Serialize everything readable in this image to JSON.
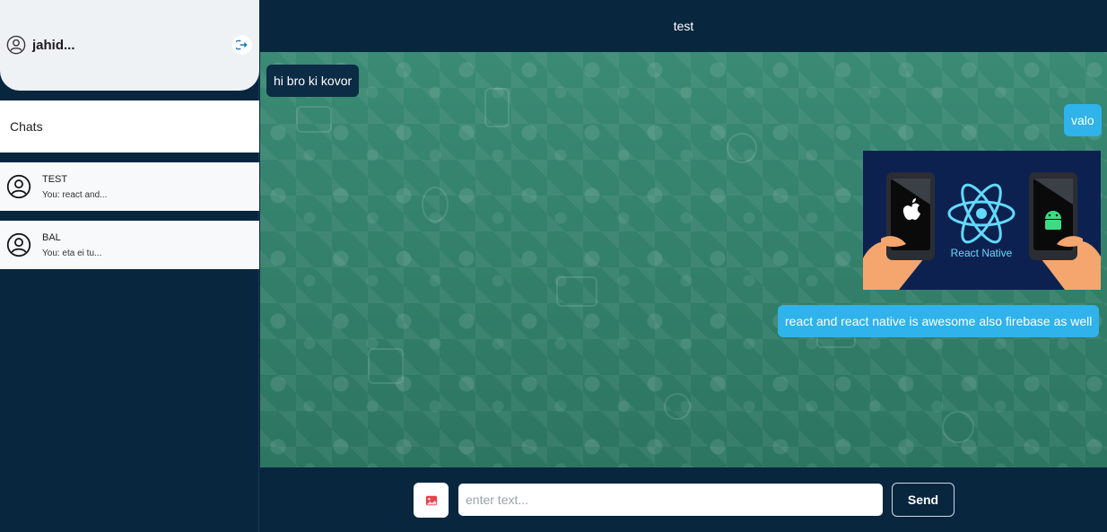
{
  "profile": {
    "username": "jahid...",
    "logout_icon": "logout-icon",
    "avatar_icon": "user-circle-icon"
  },
  "sidebar": {
    "heading": "Chats",
    "chats": [
      {
        "name": "TEST",
        "last": "You: react and..."
      },
      {
        "name": "BAL",
        "last": "You: eta ei tu..."
      }
    ]
  },
  "conversation": {
    "title": "test",
    "messages": [
      {
        "direction": "in",
        "text": "hi bro ki kovor"
      },
      {
        "direction": "out",
        "text": "valo"
      },
      {
        "direction": "out",
        "type": "image",
        "image_caption": "React Native",
        "image_icons": [
          "apple-icon",
          "react-logo-icon",
          "android-icon"
        ]
      },
      {
        "direction": "out",
        "text": "react and react native is awesome also firebase as well"
      }
    ]
  },
  "composer": {
    "placeholder": "enter text...",
    "send_label": "Send",
    "image_icon": "image-icon"
  },
  "colors": {
    "navy": "#09263f",
    "outgoing": "#30b2ea",
    "incoming": "#0c2b44",
    "chat_bg": "#2f7a66"
  }
}
